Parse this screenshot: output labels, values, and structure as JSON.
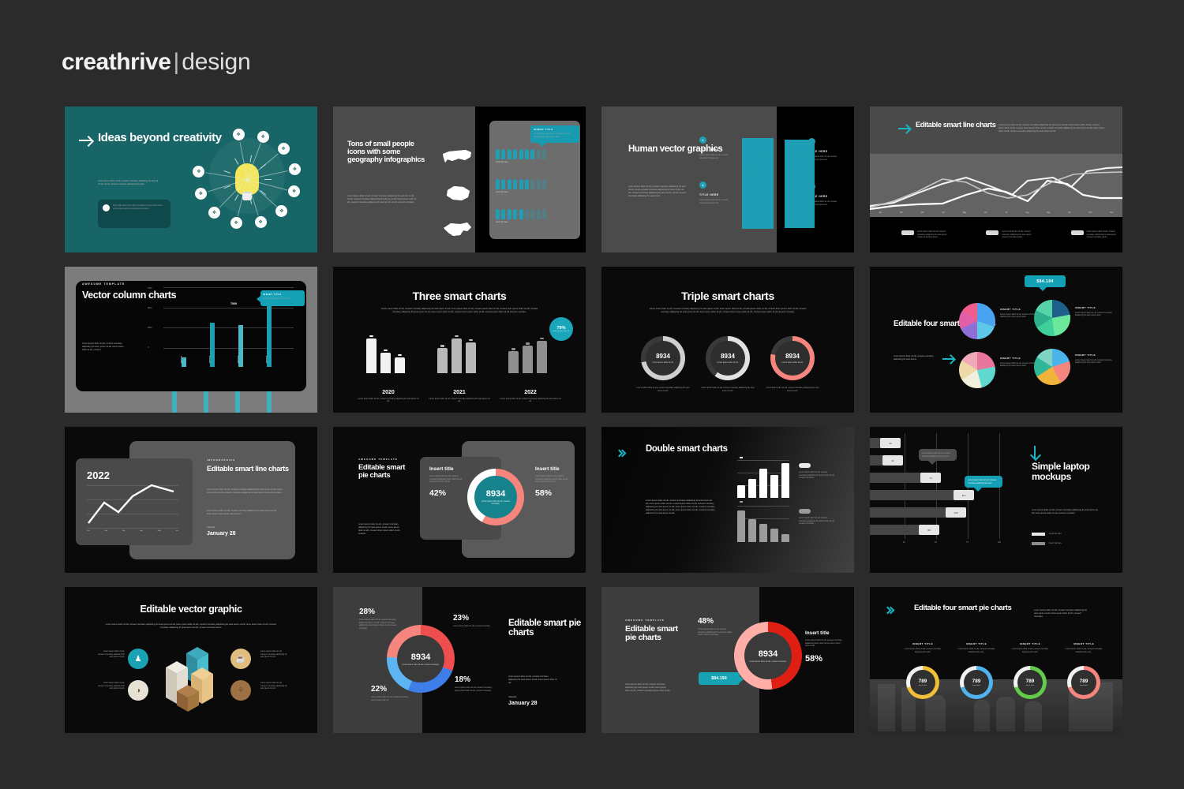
{
  "brand": {
    "name": "creathrive",
    "separator": "|",
    "suffix": "design"
  },
  "page": {
    "background": "#2b2b2b",
    "accent_teal": "#1f9fb5",
    "accent_salmon": "#f5857d"
  },
  "lorem": {
    "short": "Lorem ipsum dolor sit elit, consect monotary adipiscing hic auto ipsum sit elit.",
    "medium": "Lorem ipsum dolor sit elit, consect monotary adipiscing hic auto ipsum sit elit, consect monotary adipiscing hic auto ipsum sit elit, lorem ipsum dolor sit elit.",
    "long": "Lorem ipsum dolor sit elit, consect monotary adipiscing hic auto ipsum sit elit, consect monotary adipiscing hic auto ipsum sit elit, lorem ipsum dolor sit elit, consect monotary adipiscing hic auto ipsum sit elit, consect monotary adipiscing hic auto ipsum sit elit consect monotary.",
    "tiny": "Lorem ipsum dolor sit elit, consect monotary adipiscing."
  },
  "slides": [
    {
      "id": 1,
      "name": "ideas-beyond-creativity",
      "title": "Ideas beyond creativity",
      "background": "#186567",
      "icon": "arrow-right-icon",
      "body": "Lorem ipsum dolor sit elit, consect monotary adipiscing hic auto sit, sit elit, sit elit, consect monotary adipiscing hic auto.",
      "callout": "Post really have lorem dolor sit adipisci sit vero, amet sed it. Lorem ipsum dolor sit vero amet sed lorem.",
      "graphic": "lightbulb-network-infographic",
      "node_count": 11
    },
    {
      "id": 2,
      "name": "people-icons-geography",
      "title": "Tons of small people icons with some geography infographics",
      "body": "Lorem ipsum dolor sit elit, consect monotary adipiscing hic auto sit, sit elit, sit elit, consect monotary adipiscing hic auto sit, sit elit, lorem ipsum dolor sit elit, consect monotary adipiscing hic auto sit elit, sit elit, consect monotary.",
      "maps": [
        "usa-map-icon",
        "australia-map-icon",
        "china-map-icon"
      ],
      "bubble": {
        "title": "INSERT TITLE",
        "body": "Lorem ipsum dolor sit elit, consect monotary adipiscing hic auto ipsum dolor."
      },
      "people_rows": [
        {
          "label": "Insert title here",
          "filled": 7,
          "total": 9
        },
        {
          "label": "Insert title here",
          "filled": 6,
          "total": 9
        },
        {
          "label": "Insert title here",
          "filled": 5,
          "total": 9
        }
      ]
    },
    {
      "id": 3,
      "name": "human-vector-graphics",
      "title": "Human vector graphics",
      "body": "Lorem ipsum dolor sit elit, consect monotary adipiscing hic auto sit elit, sit elit, consect monotary adipiscing hic auto sit elit, sit elit, consect monotary adipiscing hic auto sit elit, sit elit, consect monotary adipiscing hic auto ipsum.",
      "items": [
        {
          "num": "1",
          "title": "TITLE HERE",
          "body": "Lorem ipsum dolor sit elit, consect monotary hic ipsum sit."
        },
        {
          "num": "2",
          "title": "TITLE HERE",
          "body": "Lorem ipsum dolor sit elit, consect monotary hic ipsum sit."
        },
        {
          "num": "1",
          "title": "TITLE HERE",
          "body": "Lorem ipsum dolor sit elit, consect monotary hic ipsum sit."
        },
        {
          "num": "2",
          "title": "TITLE HERE",
          "body": "Lorem ipsum dolor sit elit, consect monotary hic ipsum sit."
        }
      ],
      "silhouettes": [
        "male-silhouette",
        "female-silhouette"
      ]
    },
    {
      "id": 4,
      "name": "editable-smart-line-charts",
      "title": "Editable smart line charts",
      "icon": "arrow-right-icon",
      "body": "Lorem ipsum dolor sit elit, consect monotary adipiscing hic auto ipsum sit elit, lorem ipsum dolor sit elit, consect ipsum dolor sit elit, consect lorem ipsum dolor sit elit, consect monotary adipiscing hic auto ipsum sit elit, lorem ipsum dolor sit elit, consect monotary adipiscing hic auto ipsum sit elit.",
      "legend": [
        {
          "chip": "",
          "body": "Lorem ipsum dolor sit elit, consect monotary adipiscing hic auto ipsum consect monotary ipsum."
        },
        {
          "chip": "",
          "body": "Lorem ipsum dolor sit elit, consect monotary adipiscing hic auto ipsum consect monotary ipsum."
        },
        {
          "chip": "",
          "body": "Lorem ipsum dolor sit elit, consect monotary adipiscing hic auto ipsum consect monotary ipsum."
        }
      ],
      "x_ticks": [
        "Jan",
        "Feb",
        "Mar",
        "Apr",
        "May",
        "Jun",
        "Jul",
        "Aug",
        "Sep",
        "Oct",
        "Nov",
        "Dec"
      ]
    },
    {
      "id": 5,
      "name": "vector-column-charts",
      "eyebrow": "AWESOME TEMPLATE",
      "title": "Vector column charts",
      "body": "Lorem ipsum dolor sit elit, consect monotary adipiscing hic auto, ipsum sit elit, lorem ipsum dolor sit elit, consect.",
      "y_ticks": [
        "7500",
        "5000",
        "2500",
        "0"
      ],
      "bubble": {
        "title": "INSERT TITLE",
        "body": "Lorem ipsum dolor sit elit, consect."
      },
      "bars": [
        {
          "label": "Insert title",
          "value": 900
        },
        {
          "label": "Insert title",
          "value": 4200
        },
        {
          "label": "Insert title",
          "value": 4000
        },
        {
          "label": "Insert title",
          "value": 7000
        }
      ],
      "peak_label": "7000"
    },
    {
      "id": 6,
      "name": "three-smart-charts",
      "title": "Three smart charts",
      "body": "Lorem ipsum dolor sit elit, consect monotary adipiscing hic auto ipsum sit elit, lorem ipsum dolor sit elit, consect ipsum dolor sit elit, consect lorem ipsum dolor sit elit, consect monotary adipiscing hic auto ipsum sit elit, lorem ipsum dolor sit elit, consect lorem ipsum dolor sit elit, consect ipsum dolor sit elit consect monotary.",
      "badge": {
        "value": "79%",
        "body": "Lorem ipsum dolor sit."
      },
      "groups": [
        {
          "year": "2020",
          "values": [
            92,
            55,
            42
          ],
          "body": "Lorem ipsum dolor sit elit, consect monotary adipiscing hic auto ipsum sit elit."
        },
        {
          "year": "2021",
          "values": [
            66,
            92,
            82
          ],
          "body": "Lorem ipsum dolor sit elit, consect monotary adipiscing hic auto ipsum sit elit."
        },
        {
          "year": "2022",
          "values": [
            58,
            72,
            86
          ],
          "body": "Lorem ipsum dolor sit elit, consect monotary adipiscing hic auto ipsum sit elit."
        }
      ]
    },
    {
      "id": 7,
      "name": "triple-smart-charts",
      "title": "Triple smart charts",
      "body": "Lorem ipsum dolor sit elit, consect monotary adipiscing hic auto ipsum sit elit, lorem ipsum dolor sit elit, consect ipsum dolor sit elit, consect lorem ipsum dolor sit elit, consect monotary adipiscing hic auto ipsum sit elit, lorem ipsum dolor sit elit, consect lorem ipsum dolor sit elit, consect ipsum dolor sit elit consect monotary.",
      "rings": [
        {
          "value": "8934",
          "sub": "Lorem ipsum dolor sit elit.",
          "color": "#cfcfcf",
          "percent": 72,
          "caption": "Lorem ipsum dolor sit elit, consect monotary adipiscing hic auto ipsum sit elit."
        },
        {
          "value": "8934",
          "sub": "Lorem ipsum dolor sit elit.",
          "color": "#e2e2e2",
          "percent": 60,
          "caption": "Lorem ipsum dolor sit elit, consect monotary adipiscing hic auto ipsum sit elit."
        },
        {
          "value": "8934",
          "sub": "Lorem ipsum dolor sit elit.",
          "color": "#f5857d",
          "percent": 78,
          "caption": "Lorem ipsum dolor sit elit, consect monotary adipiscing hic auto ipsum sit elit."
        }
      ]
    },
    {
      "id": 8,
      "name": "editable-four-smart-pie-charts-a",
      "title": "Editable four smart pie charts",
      "body": "Lorem ipsum dolor sit elit, consect monotary adipiscing hic auto ipsum.",
      "icon": "arrow-right-icon",
      "bubble_value": "$84.194",
      "pies": [
        {
          "title": "INSERT TITLE",
          "body": "Lorem ipsum dolor sit elit, consect monotary adipiscing hic auto ipsum dolor.",
          "colors": [
            "#4aa3f0",
            "#5fc8e8",
            "#8e6fd6",
            "#e05fa8",
            "#f05f8c"
          ],
          "values": [
            30,
            20,
            18,
            17,
            15
          ]
        },
        {
          "title": "INSERT TITLE",
          "body": "Lorem ipsum dolor sit elit, consect monotary adipiscing hic auto ipsum dolor.",
          "colors": [
            "#1e5f8c",
            "#6ce89a",
            "#3fcf9b",
            "#2fae8e",
            "#56d4a8"
          ],
          "values": [
            22,
            26,
            18,
            16,
            18
          ]
        },
        {
          "title": "INSERT TITLE",
          "body": "Lorem ipsum dolor sit elit, consect monotary adipiscing hic auto ipsum dolor.",
          "colors": [
            "#e8779b",
            "#5fd9cf",
            "#f2f0dc",
            "#efd9a8",
            "#f0a9b8"
          ],
          "values": [
            22,
            24,
            20,
            18,
            16
          ]
        },
        {
          "title": "INSERT TITLE",
          "body": "Lorem ipsum dolor sit elit, consect monotary adipiscing hic auto ipsum dolor.",
          "colors": [
            "#4ab5e8",
            "#f5867f",
            "#f2b33a",
            "#2fb79a",
            "#7fd4c4"
          ],
          "values": [
            20,
            22,
            24,
            18,
            16
          ]
        }
      ]
    },
    {
      "id": 9,
      "name": "editable-smart-line-charts-card",
      "eyebrow": "INFOGRAPHICS",
      "title": "Editable smart line charts",
      "year": "2022",
      "body": "Lorem ipsum dolor sit elit, consect monotary adipiscing hic auto ipsum sit elit, lorem ipsum dolor sit elit, consect monotary adipiscing hic auto ipsum sit elit, lorem ipsum.",
      "body2": "Lorem ipsum dolor sit elit, consect monotary adipiscing hic auto ipsum sit elit, lorem ipsum dolor sit elit, lorem ipsum.",
      "date_label": "Calendar",
      "date": "January 28",
      "x_ticks": [
        "Jan",
        "Feb",
        "Mar",
        "Apr",
        "May",
        "Jun"
      ],
      "line_values": [
        12,
        48,
        34,
        56,
        80,
        70
      ]
    },
    {
      "id": 10,
      "name": "editable-smart-pie-charts-a",
      "eyebrow": "AWESOME TEMPLATE",
      "title": "Editable smart pie charts",
      "body": "Lorem ipsum dolor sit elit, consect monotary adipiscing hic auto ipsum sit elit, lorem ipsum dolor sit elit, consect lorem ipsum dolor sit elit, consect.",
      "left": {
        "title": "Insert title",
        "body": "Lorem ipsum dolor sit elit, consect monotary adipiscing ipsum dolor sit elit, lorem ipsum dolor sit elit.",
        "percent": "42%"
      },
      "right": {
        "title": "Insert title",
        "body": "Lorem ipsum dolor sit elit, consect monotary adipiscing ipsum dolor sit elit, lorem ipsum dolor sit elit.",
        "percent": "58%"
      },
      "donut": {
        "value": "8934",
        "sub": "Lorem ipsum dolor sit elit, consect monotary.",
        "colors": [
          "#f5857d",
          "#ffffff"
        ],
        "split": [
          58,
          42
        ]
      }
    },
    {
      "id": 11,
      "name": "double-smart-charts",
      "title": "Double smart charts",
      "icon": "double-chevron-right-icon",
      "body": "Lorem ipsum dolor sit elit, consect monotary adipiscing hic auto ipsum sit elit, lorem ipsum dolor sit elit, consect ipsum dolor sit elit, consect monotary adipiscing hic auto ipsum sit elit, lorem ipsum dolor sit elit, consect monotary adipiscing hic auto ipsum sit elit, lorem ipsum dolor sit elit, consect monotary adipiscing hic auto ipsum sit elit.",
      "chart_top": {
        "values": [
          34,
          52,
          80,
          62,
          95
        ],
        "color": "#ffffff",
        "legend": "Lorem ipsum dolor sit elit, consect monotary adipiscing hic auto sit elit, sit elit, consect monotary."
      },
      "chart_bottom": {
        "values": [
          88,
          62,
          50,
          38,
          22
        ],
        "color": "#9c9c9c",
        "legend": "Lorem ipsum dolor sit elit, consect monotary adipiscing hic auto sit elit, sit elit, consect monotary."
      }
    },
    {
      "id": 12,
      "name": "simple-laptop-mockups",
      "title": "Simple laptop mockups",
      "icon": "arrow-down-icon",
      "body": "Lorem ipsum dolor sit elit, consect monotary adipiscing hic auto ipsum sit elit, lorem ipsum dolor sit elit, consect monotary.",
      "bars": [
        {
          "value": 35,
          "label": "30"
        },
        {
          "value": 38,
          "label": "32"
        },
        {
          "value": 86,
          "label": "74"
        },
        {
          "value": 128,
          "label": "112"
        },
        {
          "value": 118,
          "label": "100"
        },
        {
          "value": 84,
          "label": "68"
        }
      ],
      "x_ticks": [
        "25",
        "50",
        "75",
        "100"
      ],
      "tooltip_gray": "Lorem ipsum dolor sit elit, consect monotary adipiscing hic auto sit.",
      "tooltip_teal": "Lorem ipsum dolor sit elit, consect monotary adipiscing hic auto.",
      "legend": [
        {
          "label": "Insert title here"
        },
        {
          "label": "Insert title here"
        }
      ]
    },
    {
      "id": 13,
      "name": "editable-vector-graphic",
      "title": "Editable vector graphic",
      "body": "Lorem ipsum dolor sit elit, consect monotary adipiscing hic auto ipsum sit elit, lorem ipsum dolor sit elit, consect monotary adipiscing hic auto ipsum sit elit, lorem ipsum dolor sit elit, consect monotary adipiscing hic auto ipsum sit elit, consect monotary ipsum.",
      "items": [
        {
          "icon": "user-icon",
          "glyph": "♟",
          "color": "#1ba2b5",
          "body": "Lorem ipsum dolor sit elit, consect monotary adipiscing hic auto ipsum sit elit."
        },
        {
          "icon": "coffee-icon",
          "glyph": "☕",
          "color": "#e0bd7e",
          "body": "Lorem ipsum dolor sit elit, consect monotary adipiscing hic auto ipsum sit elit."
        },
        {
          "icon": "palette-icon",
          "glyph": "◑",
          "color": "#e6e3d4",
          "body": "Lorem ipsum dolor sit elit, consect monotary adipiscing hic auto ipsum sit elit."
        },
        {
          "icon": "trophy-icon",
          "glyph": "⚘",
          "color": "#9d7144",
          "body": "Lorem ipsum dolor sit elit, consect monotary adipiscing hic auto ipsum sit elit."
        }
      ],
      "graphic": "isometric-3d-bar-blocks"
    },
    {
      "id": 14,
      "name": "editable-smart-pie-charts-b",
      "title": "Editable smart pie charts",
      "date_label": "Calendar",
      "date": "January 28",
      "body": "Lorem ipsum dolor sit elit, consect monotary adipiscing hic auto ipsum sit elit, lorem ipsum dolor sit elit.",
      "donut": {
        "value": "8934",
        "sub": "Lorem ipsum dolor sit elit, consect monotary."
      },
      "segments": [
        {
          "percent": "28%",
          "color": "#ef4e4e",
          "value": 28,
          "body": "Lorem ipsum dolor sit elit, consect monotary adipiscing ipsum, sit elit, consect monotary adipiscing, lorem ipsum dolor sit elit, consect monotary."
        },
        {
          "percent": "23%",
          "color": "#3d7ee8",
          "value": 23,
          "body": "Lorem ipsum dolor sit elit, consect monotary."
        },
        {
          "percent": "18%",
          "color": "#5cb4f2",
          "value": 18,
          "body": "Lorem ipsum dolor sit elit, consect monotary, lorem ipsum dolor sit elit, consect monotary."
        },
        {
          "percent": "22%",
          "color": "#f5857d",
          "value": 22,
          "body": "Lorem ipsum dolor sit elit, consect monotary, lorem ipsum dolor sit."
        }
      ]
    },
    {
      "id": 15,
      "name": "editable-smart-pie-charts-c",
      "eyebrow": "AWESOME TEMPLATE",
      "title": "Editable smart pie charts",
      "body": "Lorem ipsum dolor sit elit, consect monotary adipiscing hic auto ipsum sit elit, lorem ipsum dolor sit elit, consect monotary ipsum dolor sit elit.",
      "left": {
        "percent": "48%",
        "body": "Lorem ipsum dolor sit elit, consect monotary adipiscing hic auto ipsum dolor sit elit, consect monotary."
      },
      "right": {
        "title": "Insert title",
        "body": "Lorem ipsum dolor sit elit, consect monotary adipiscing ipsum dolor sit elit, lorem ipsum dolor sit elit.",
        "percent": "58%"
      },
      "donut": {
        "value": "8934",
        "sub": "Lorem ipsum dolor sit elit, consect monotary.",
        "colors": [
          "#e01f14",
          "#ffafa8"
        ],
        "split": [
          48,
          52
        ]
      },
      "bubble_value": "$84.194"
    },
    {
      "id": 16,
      "name": "editable-four-smart-pie-charts-b",
      "title": "Editable four smart pie charts",
      "icon": "double-chevron-right-icon",
      "body": "Lorem ipsum dolor sit elit, consect monotary adipiscing hic auto ipsum sit elit, lorem ipsum dolor sit elit, consect monotary.",
      "rings": [
        {
          "title": "INSERT TITLE",
          "body": "Lorem ipsum dolor sit elit, consect monotary adipiscing hic auto.",
          "value": "789",
          "sub": "Insert here",
          "color": "#f2c038",
          "percent": 70
        },
        {
          "title": "INSERT TITLE",
          "body": "Lorem ipsum dolor sit elit, consect monotary adipiscing hic auto.",
          "value": "789",
          "sub": "Insert here",
          "color": "#4fb4ee",
          "percent": 70
        },
        {
          "title": "INSERT TITLE",
          "body": "Lorem ipsum dolor sit elit, consect monotary adipiscing hic auto.",
          "value": "789",
          "sub": "Insert here",
          "color": "#62cc4a",
          "percent": 70
        },
        {
          "title": "INSERT TITLE",
          "body": "Lorem ipsum dolor sit elit, consect monotary adipiscing hic auto.",
          "value": "789",
          "sub": "Insert here",
          "color": "#f5857d",
          "percent": 70
        }
      ],
      "photo": "office-team-photo-grayscale"
    }
  ]
}
